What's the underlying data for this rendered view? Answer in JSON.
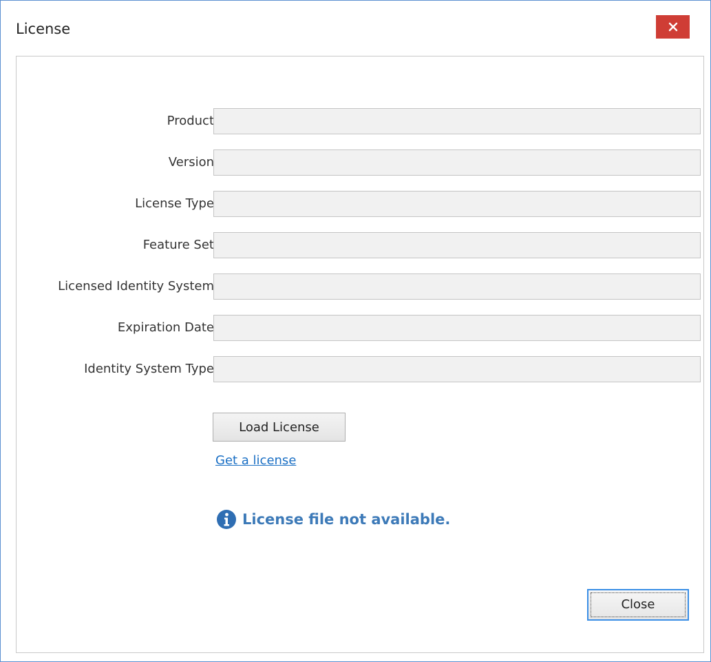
{
  "window": {
    "title": "License"
  },
  "form": {
    "fields": [
      {
        "label": "Product",
        "value": ""
      },
      {
        "label": "Version",
        "value": ""
      },
      {
        "label": "License Type",
        "value": ""
      },
      {
        "label": "Feature Set",
        "value": ""
      },
      {
        "label": "Licensed Identity System",
        "value": ""
      },
      {
        "label": "Expiration Date",
        "value": ""
      },
      {
        "label": "Identity System Type",
        "value": ""
      }
    ]
  },
  "actions": {
    "load_license_label": "Load License",
    "get_license_label": "Get a license",
    "close_label": "Close"
  },
  "status": {
    "message": "License file not available.",
    "icon": "info-icon"
  },
  "colors": {
    "accent": "#3a8ee6",
    "close_title": "#cf3d35",
    "status_text": "#3d7ab8",
    "link": "#1a6fc4"
  }
}
